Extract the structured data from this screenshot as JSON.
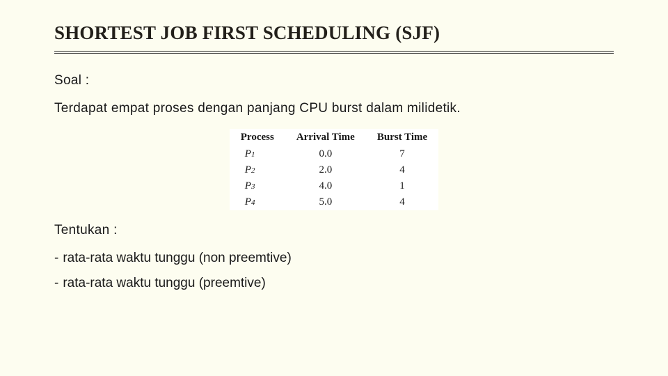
{
  "title": "SHORTEST JOB FIRST SCHEDULING (SJF)",
  "soal_label": "Soal :",
  "intro": "Terdapat empat proses dengan panjang CPU burst dalam milidetik.",
  "table": {
    "headers": {
      "process": "Process",
      "arrival": "Arrival Time",
      "burst": "Burst Time"
    },
    "rows": [
      {
        "process_base": "P",
        "process_sub": "1",
        "arrival": "0.0",
        "burst": "7"
      },
      {
        "process_base": "P",
        "process_sub": "2",
        "arrival": "2.0",
        "burst": "4"
      },
      {
        "process_base": "P",
        "process_sub": "3",
        "arrival": "4.0",
        "burst": "1"
      },
      {
        "process_base": "P",
        "process_sub": "4",
        "arrival": "5.0",
        "burst": "4"
      }
    ]
  },
  "tentukan_label": "Tentukan :",
  "bullets": {
    "dash": "-",
    "items": [
      "rata-rata waktu tunggu (non preemtive)",
      "rata-rata waktu tunggu (preemtive)"
    ]
  }
}
